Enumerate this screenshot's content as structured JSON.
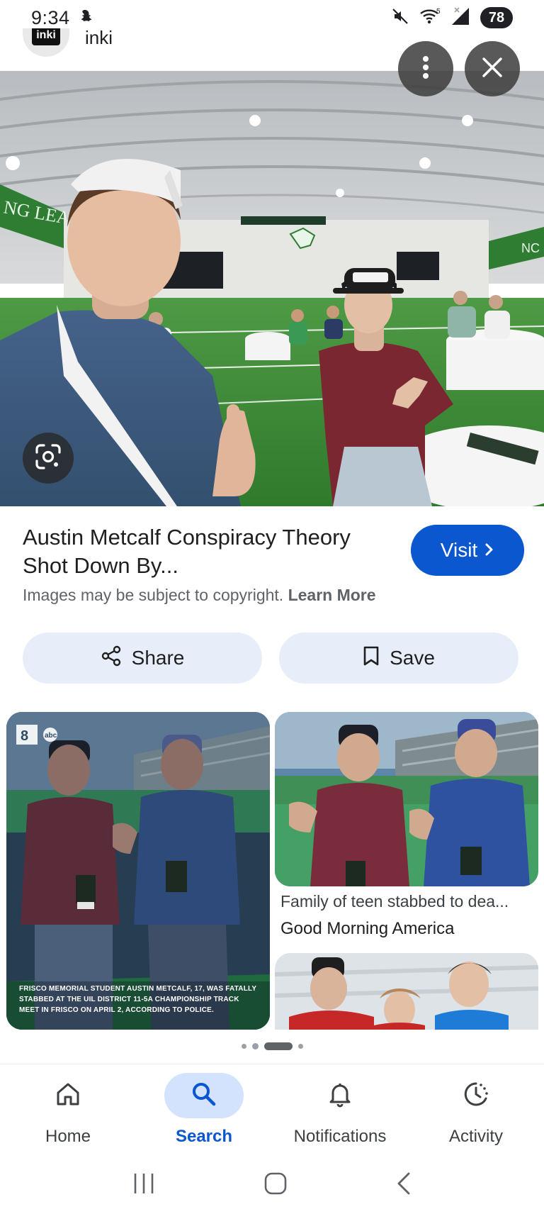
{
  "status_bar": {
    "time": "9:34",
    "battery": "78",
    "signal_label": "5",
    "icons": [
      "snapchat-icon",
      "mute-icon",
      "wifi-icon",
      "signal-icon",
      "battery-icon"
    ]
  },
  "source": {
    "name": "inki",
    "logo_text": "inki"
  },
  "hero": {
    "menu_icon": "more-vert-icon",
    "close_icon": "close-icon",
    "lens_icon": "lens-icon",
    "banner_text": "NG LEAD",
    "banner_text_right": "NC"
  },
  "result": {
    "title": "Austin Metcalf Conspiracy Theory Shot Down By...",
    "visit_label": "Visit",
    "copyright_text": "Images may be subject to copyright.",
    "learn_more": "Learn More"
  },
  "actions": {
    "share_label": "Share",
    "save_label": "Save"
  },
  "related": {
    "left_caption_parts": [
      "FRISCO MEMORIAL STUDENT ",
      "AUSTIN METCALF",
      ", 17, WAS ",
      "FATALLY STABBED",
      " AT THE UIL DISTRICT 11-5A CHAMPIONSHIP ",
      "TRACK MEET IN FRISCO",
      " ON APRIL 2, ACCORDING TO POLICE."
    ],
    "left_badge": "8 abc",
    "right_title": "Family of teen stabbed to dea...",
    "right_source": "Good Morning America"
  },
  "pager": {
    "current_page": 3,
    "total_pages": 4
  },
  "bottom_nav": {
    "items": [
      {
        "label": "Home",
        "icon": "home-icon"
      },
      {
        "label": "Search",
        "icon": "search-icon"
      },
      {
        "label": "Notifications",
        "icon": "bell-icon"
      },
      {
        "label": "Activity",
        "icon": "activity-icon"
      }
    ],
    "active_index": 1
  },
  "colors": {
    "accent": "#0b57d0",
    "pill_bg": "#e7eef9",
    "nav_active_bg": "#d3e3fd",
    "turf_green": "#3f8a3a"
  }
}
